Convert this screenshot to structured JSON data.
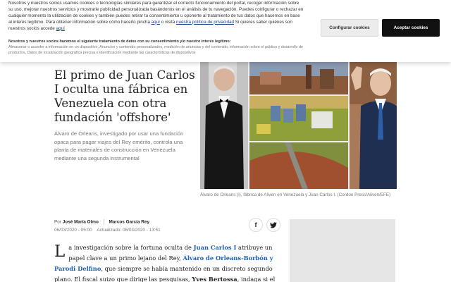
{
  "cookie": {
    "text_1": "Nosotros y nuestros socios usamos cookies o tecnologías similares para garantizar el correcto funcionamiento del portal, recoger información sobre su uso, mejorar nuestros servicios y mostrarle publicidad personalizada basándonos en el análisis de tu navegación.",
    "text_2": "Puedes configurar o rechazar en cualquier momento la utilización de cookies y también puedes retirar tu consentimiento u oponerte al tratamiento de tus datos que hacemos en base al interés legítimo. Para obtener información sobre cómo hacerlo pincha",
    "link_aqui_1": "aquí",
    "text_3": "o visita",
    "link_policy": "nuestra política de privacidad",
    "text_4": "Si quieres saber quiénes son nuestros socios accede",
    "link_aqui_2": "aquí",
    "legit_title": "Nosotros y nuestros socios hacemos el siguiente tratamiento de datos con su consentimiento y/o nuestro interés legítimo:",
    "legit_text": "Almacenar o acceder a información en un dispositivo, Anuncios y contenido personalizados, medición de anuncios y del contenido, información sobre el público y desarrollo de productos, Datos de localización geográfica precisa e identificación mediante las características de dispositivos",
    "config_label": "Configurar cookies",
    "accept_label": "Aceptar cookies"
  },
  "article": {
    "headline": "El primo de Juan Carlos I oculta una fábrica en Venezuela con otra fundación 'offshore'",
    "subheadline": "Álvaro de Órleans, investigado por usar una fundación opaca para pagar viajes del Rey emérito, controla una planta de materiales de construcción en Venezuela mediante una segunda instrumental",
    "caption": "Álvaro de Orleans (i), fábrica de Aliven en Venezuela y Juan Carlos I. (Cordon Press/Aliven/EFE)",
    "byline_prefix": "Por",
    "author_1": "José María Olmo",
    "author_2": "Marcos García Rey",
    "published": "06/03/2020 - 05:00",
    "updated": "Actualizado: 06/03/2020 - 13:51",
    "share_facebook": "f",
    "share_twitter": "t",
    "dropcap": "L",
    "body": {
      "p1": "a investigación sobre la fortuna oculta de",
      "link_1": "Juan Carlos I",
      "p2": "atribuye un papel clave a un primo lejano del Rey,",
      "link_2": "Álvaro de Orleans-Borbón y Parodi Delfino",
      "p3": ", que siempre se había mantenido en un discreto segundo plano. El fiscal suizo que dirige las pesquisas,",
      "bold_1": "Yves Bertossa",
      "p4": ", indaga si el monarca utilizó a este"
    }
  },
  "colors": {
    "link": "#1a5fb4",
    "accept_button": "#111111"
  }
}
